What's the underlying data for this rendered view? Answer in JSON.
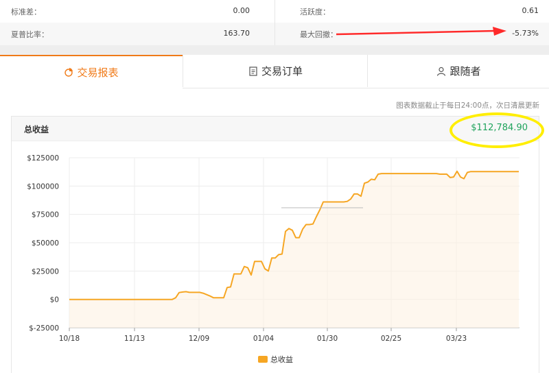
{
  "stats": {
    "std_label": "标准差：",
    "std_value": "0.00",
    "activity_label": "活跃度：",
    "activity_value": "0.61",
    "sharpe_label": "夏普比率：",
    "sharpe_value": "163.70",
    "drawdown_label": "最大回撤：",
    "drawdown_value": "-5.73%"
  },
  "tabs": [
    {
      "label": "交易报表",
      "icon": "pie-chart-icon",
      "active": true
    },
    {
      "label": "交易订单",
      "icon": "document-icon",
      "active": false
    },
    {
      "label": "跟随者",
      "icon": "user-icon",
      "active": false
    }
  ],
  "note": "图表数据截止于每日24:00点，次日清晨更新",
  "panel": {
    "title": "总收益",
    "total": "$112,784.90"
  },
  "colors": {
    "accent": "#f07a18",
    "line": "#f6a623",
    "positive": "#1fa35c",
    "annotation_arrow": "#ff2a2a",
    "annotation_circle": "#ffee00"
  },
  "chart_data": {
    "type": "area",
    "y_ticks": [
      "$125000",
      "$100000",
      "$75000",
      "$50000",
      "$25000",
      "$0",
      "$-25000"
    ],
    "x_ticks": [
      "10/18",
      "11/13",
      "12/09",
      "01/04",
      "01/30",
      "02/25",
      "03/23"
    ],
    "ylim": [
      -25000,
      125000
    ],
    "grid": true,
    "legend": "bottom-center",
    "series": [
      {
        "name": "总收益",
        "x": [
          0,
          150,
          155,
          160,
          165,
          170,
          175,
          185,
          190,
          195,
          205,
          210,
          215,
          225,
          230,
          235,
          240,
          245,
          250,
          255,
          260,
          265,
          270,
          275,
          280,
          285,
          290,
          295,
          300,
          305,
          310,
          315,
          320,
          325,
          330,
          335,
          340,
          345,
          350,
          355,
          360,
          365,
          370,
          375,
          380,
          385,
          390,
          395,
          400,
          405,
          410,
          415,
          420,
          425,
          430,
          435,
          440,
          445,
          450,
          455,
          460,
          465,
          470,
          475,
          480,
          485,
          490,
          495,
          500,
          505,
          510,
          515,
          520,
          525,
          530,
          535,
          540,
          545,
          550,
          555,
          560,
          565,
          570,
          575,
          580,
          585,
          590,
          595,
          600,
          605,
          610,
          615,
          620,
          625,
          630,
          635,
          640,
          645,
          650,
          655
        ],
        "values": [
          0,
          0,
          1500,
          6000,
          6500,
          6800,
          6200,
          6200,
          6200,
          5500,
          3000,
          1500,
          1500,
          1500,
          10500,
          11000,
          22500,
          22500,
          22500,
          29000,
          28000,
          21500,
          33500,
          33500,
          33500,
          27000,
          25000,
          36500,
          36500,
          39500,
          40000,
          60000,
          62500,
          61000,
          54500,
          54500,
          62000,
          66000,
          66000,
          66500,
          73000,
          79000,
          86000,
          86000,
          86000,
          86000,
          86000,
          86000,
          86000,
          86500,
          88500,
          93000,
          93000,
          91000,
          102500,
          103500,
          106000,
          105500,
          110500,
          111000,
          111000,
          111000,
          111000,
          111000,
          111000,
          111000,
          111000,
          111000,
          111000,
          111000,
          111000,
          111000,
          111000,
          111000,
          111000,
          111000,
          110500,
          110500,
          110500,
          107500,
          108000,
          113000,
          108000,
          106500,
          112000,
          112800,
          112800,
          112800,
          112800,
          112800,
          112800,
          112800,
          112800,
          112800,
          112800,
          112800,
          112800,
          112800,
          112800,
          112800
        ]
      }
    ]
  }
}
